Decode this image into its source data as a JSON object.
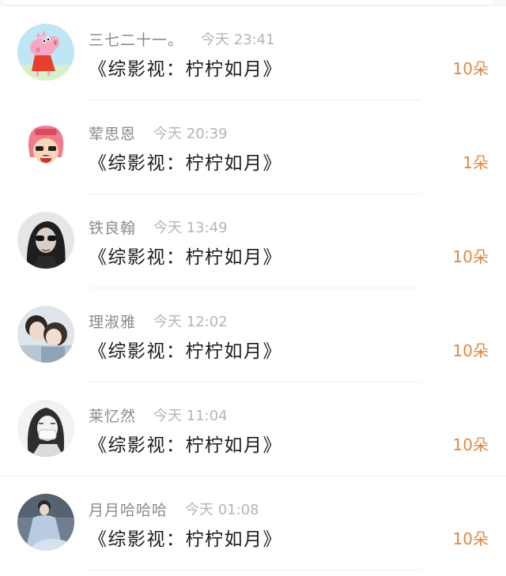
{
  "entries": [
    {
      "name": "三七二十一。",
      "time": "今天 23:41",
      "title": "《综影视：柠柠如月》",
      "count": "10朵",
      "avatar": "peppa-pig-avatar"
    },
    {
      "name": "荤思恩",
      "time": "今天 20:39",
      "title": "《综影视：柠柠如月》",
      "count": "1朵",
      "avatar": "pink-hair-cartoon-avatar"
    },
    {
      "name": "铁良翰",
      "time": "今天 13:49",
      "title": "《综影视：柠柠如月》",
      "count": "10朵",
      "avatar": "sunglasses-portrait-avatar"
    },
    {
      "name": "理淑雅",
      "time": "今天 12:02",
      "title": "《综影视：柠柠如月》",
      "count": "10朵",
      "avatar": "couple-photo-avatar"
    },
    {
      "name": "莱忆然",
      "time": "今天 11:04",
      "title": "《综影视：柠柠如月》",
      "count": "10朵",
      "avatar": "masked-girl-sketch-avatar"
    },
    {
      "name": "月月哈哈哈",
      "time": "今天 01:08",
      "title": "《综影视：柠柠如月》",
      "count": "10朵",
      "avatar": "blue-dress-portrait-avatar"
    }
  ],
  "colors": {
    "accent": "#e2873f",
    "name": "#8a8a8a",
    "time": "#b5b5b5",
    "title": "#1b1b1b"
  }
}
